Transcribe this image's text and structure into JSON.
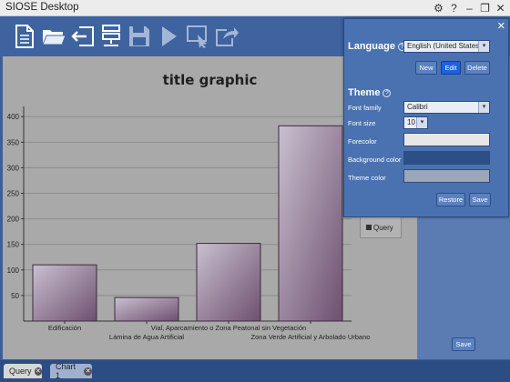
{
  "window": {
    "title": "SIOSE Desktop"
  },
  "titlebar_icons": [
    "gear-icon",
    "help-icon",
    "minimize-icon",
    "restore-icon",
    "close-icon"
  ],
  "titlebar_glyphs": {
    "gear": "⚙",
    "help": "?",
    "minimize": "–",
    "restore": "❐",
    "close": "✕"
  },
  "toolbar": {
    "tools": [
      "new-document-icon",
      "open-folder-icon",
      "import-icon",
      "server-icon",
      "save-icon",
      "run-icon",
      "select-area-icon",
      "export-icon"
    ]
  },
  "chart_data": {
    "type": "bar",
    "title": "title graphic",
    "categories": [
      "Edificación",
      "Lámina de Agua Artificial",
      "Vial, Aparcamiento o Zona Peatonal sin Vegetación",
      "Zona Verde Artificial y Arbolado Urbano"
    ],
    "values": [
      110,
      46,
      152,
      382
    ],
    "ylim": [
      0,
      420
    ],
    "yticks": [
      50,
      100,
      150,
      200,
      250,
      300,
      350,
      400
    ],
    "ytick_labels": [
      "50",
      "100",
      "150",
      "200",
      "250",
      "300",
      "350",
      "400"
    ],
    "grid": true,
    "colors": {
      "bar_top": "#c9c0cf",
      "bar_bottom": "#6e5070",
      "bar_edge": "#3a2a3c"
    }
  },
  "legend": {
    "label": "Query"
  },
  "settings_dialog": {
    "close_glyph": "✕",
    "language": {
      "title": "Language",
      "help": "?",
      "selected": "English (United States)",
      "buttons": {
        "new": "New",
        "edit": "Edit",
        "delete": "Delete"
      }
    },
    "theme": {
      "title": "Theme",
      "help": "?",
      "font_family_label": "Font family",
      "font_family_value": "Calibri",
      "font_size_label": "Font size",
      "font_size_value": "10",
      "forecolor_label": "Forecolor",
      "background_color_label": "Background color",
      "theme_color_label": "Theme color",
      "colors": {
        "forecolor": "#e7e7e7",
        "background": "#2e4f86",
        "theme": "#9ba6b8"
      },
      "buttons": {
        "restore": "Restore",
        "save": "Save"
      }
    }
  },
  "panel": {
    "save_label": "Save"
  },
  "tabs": [
    {
      "label": "Query",
      "close": "✕"
    },
    {
      "label": "Chart 1",
      "close": "✕"
    }
  ],
  "arrow_glyph": "▾"
}
